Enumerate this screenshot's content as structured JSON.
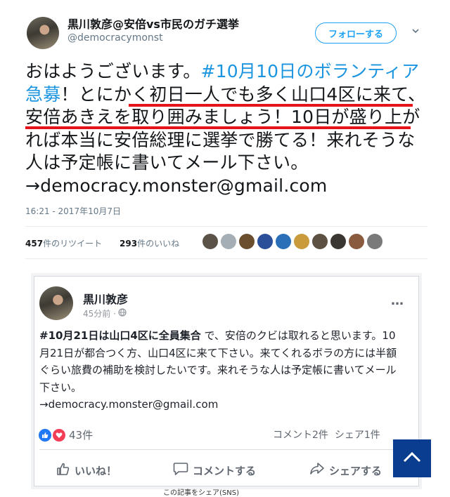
{
  "tweet": {
    "display_name": "黒川敦彦@安倍vs市民のガチ選挙",
    "handle": "@democracymonst",
    "follow_label": "フォローする",
    "text_part1": "おはようございます。",
    "hashtag": "#10月10日のボランティア急募",
    "text_part2": "！",
    "text_highlight": "とにかく初日一人でも多く山口4区に来て、安倍あきえを取り囲みましょう！",
    "text_part3": "10日が盛り上がれば本当に安倍総理に選挙で勝てる！来れそうな人は予定帳に書いてメール下さい。→democracy.monster@gmail.com",
    "timestamp": "16:21 - 2017年10月7日",
    "retweets_count": "457",
    "retweets_label": "件のリツイート",
    "likes_count": "293",
    "likes_label": "件のいいね"
  },
  "fb_post": {
    "author": "黒川敦彦",
    "time": "45分前 ·",
    "more_icon": "…",
    "hashtag": "#10月21日は山口4区に全員集合",
    "text": " で、安倍のクビは取れると思います。10月21日が都合つく方、山口4区に来て下さい。来てくれるボラの方には半額ぐらい旅費の補助を検討したいです。来れそうな人は予定帳に書いてメール下さい。",
    "email": "→democracy.monster@gmail.com",
    "reactions_count": "43件",
    "comments_count": "コメント2件",
    "shares_count": "シェア1件",
    "action_like": "いいね！",
    "action_comment": "コメントする",
    "action_share": "シェアする"
  },
  "footer": {
    "share_text": "この記事をシェア(SNS)"
  },
  "colors": {
    "hashtag": "#1b95e0",
    "underline": "#e5131a",
    "follow": "#1da1f2",
    "scroll_top_bg": "#0a3c8f"
  },
  "icons": {
    "caret": "chevron-down-icon",
    "globe": "globe-icon",
    "like": "thumbs-up-icon",
    "comment": "comment-icon",
    "share": "share-arrow-icon",
    "scroll_top": "arrow-up-icon"
  }
}
